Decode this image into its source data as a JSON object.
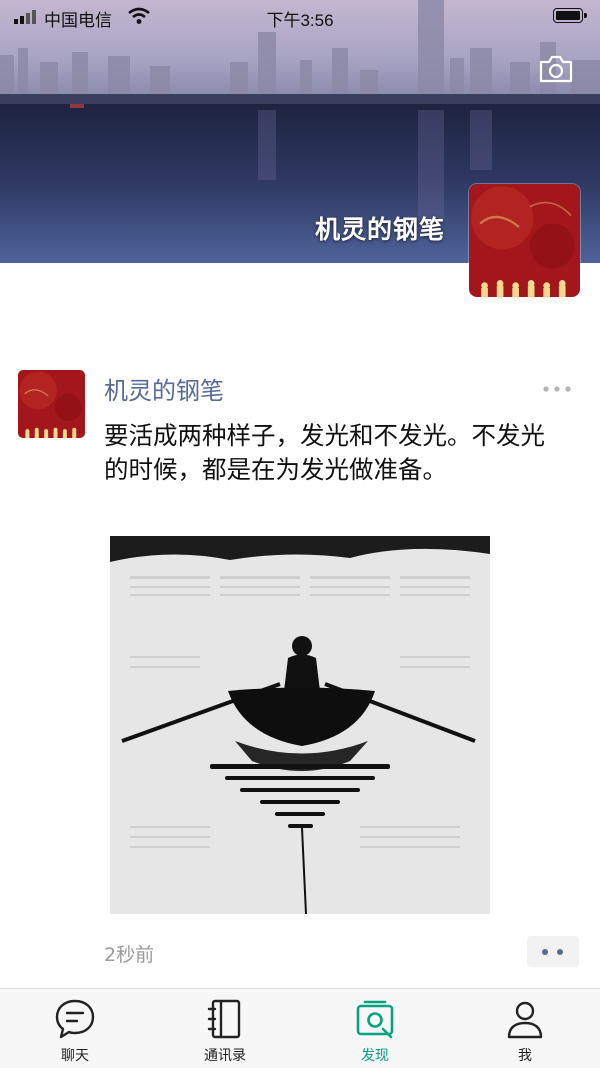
{
  "status_bar": {
    "carrier": "中国电信",
    "time": "下午3:56"
  },
  "cover": {
    "profile_name": "机灵的钢笔"
  },
  "post": {
    "author": "机灵的钢笔",
    "text": "要活成两种样子，发光和不发光。不发光的时候，都是在为发光做准备。",
    "time": "2秒前"
  },
  "tabbar": {
    "tabs": [
      {
        "label": "聊天",
        "icon": "chat-bubble-icon",
        "active": false
      },
      {
        "label": "通讯录",
        "icon": "contacts-book-icon",
        "active": false
      },
      {
        "label": "发现",
        "icon": "discover-compass-icon",
        "active": true
      },
      {
        "label": "我",
        "icon": "person-icon",
        "active": false
      }
    ]
  },
  "colors": {
    "link_name": "#576b95",
    "tab_active": "#07a37f",
    "avatar_red": "#a3161b"
  }
}
